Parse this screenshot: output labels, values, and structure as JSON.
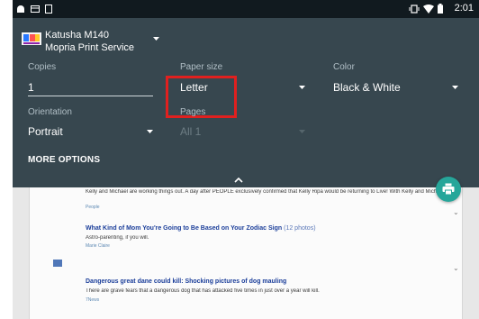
{
  "status_bar": {
    "time": "2:01"
  },
  "printer": {
    "name": "Katusha M140",
    "service": "Mopria Print Service"
  },
  "settings": {
    "copies": {
      "label": "Copies",
      "value": "1"
    },
    "paper_size": {
      "label": "Paper size",
      "value": "Letter"
    },
    "color": {
      "label": "Color",
      "value": "Black & White"
    },
    "orientation": {
      "label": "Orientation",
      "value": "Portrait"
    },
    "pages": {
      "label": "Pages",
      "value": "All 1"
    },
    "more_options": "MORE OPTIONS"
  },
  "preview": {
    "items": [
      {
        "snippet": "Kelly and Michael are working things out. A day after PEOPLE exclusively confirmed that Kelly Ripa would be returning to Live! With Kelly and Michael! after a nearly weeklong absence, a source says Michael Strahan is excited to have her back.",
        "source": "People"
      },
      {
        "title": "What Kind of Mom You're Going to Be Based on Your Zodiac Sign",
        "count": "(12 photos)",
        "snippet": "Astro-parenting, if you will.",
        "source": "Marie Claire"
      },
      {
        "title": "Dangerous great dane could kill: Shocking pictures of dog mauling",
        "snippet": "There are grave fears that a dangerous dog that has attacked five times in just over a year will kill.",
        "source": "7News"
      }
    ]
  },
  "colors": {
    "panel": "#37474f",
    "accent_fab": "#26a69a",
    "highlight": "#e0201f"
  }
}
